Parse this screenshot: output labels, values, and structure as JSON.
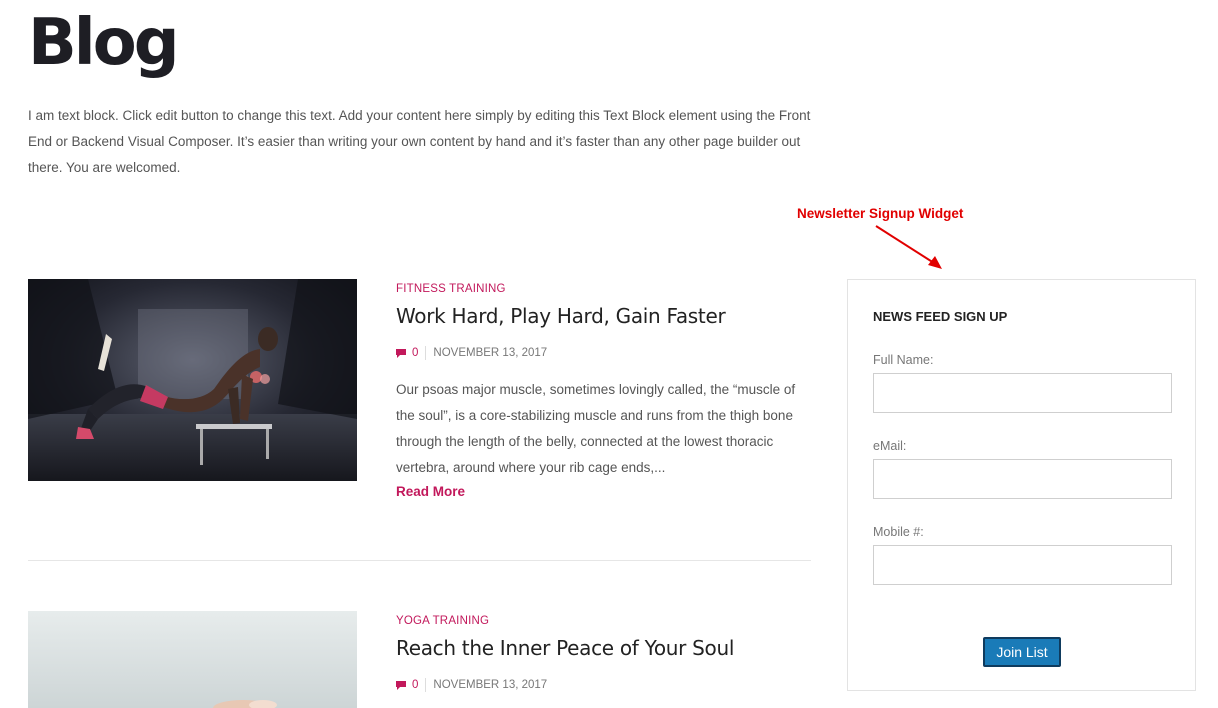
{
  "page": {
    "title": "Blog",
    "intro": "I am text block. Click edit button to change this text. Add your content here simply by editing this Text Block element using the Front End or Backend Visual Composer. It’s easier than writing your own content by hand and it’s faster than any other page builder out there. You are welcomed."
  },
  "annotation": {
    "label": "Newsletter Signup Widget",
    "color": "#e10000"
  },
  "posts": [
    {
      "category": "FITNESS TRAINING",
      "title": "Work Hard, Play Hard, Gain Faster",
      "comments": "0",
      "date": "NOVEMBER 13, 2017",
      "excerpt": "Our psoas major muscle, sometimes lovingly called, the “muscle of the soul”, is a core-stabilizing muscle and runs from the thigh bone through the length of the belly, connected at the lowest thoracic vertebra, around where your rib cage ends,...",
      "read_more": "Read More",
      "image_icon": "athlete-pushup-photo"
    },
    {
      "category": "YOGA TRAINING",
      "title": "Reach the Inner Peace of Your Soul",
      "comments": "0",
      "date": "NOVEMBER 13, 2017",
      "image_icon": "yoga-photo"
    }
  ],
  "widget": {
    "title": "NEWS FEED SIGN UP",
    "fields": [
      {
        "label": "Full Name:",
        "value": ""
      },
      {
        "label": "eMail:",
        "value": ""
      },
      {
        "label": "Mobile #:",
        "value": ""
      }
    ],
    "button_label": "Join List"
  },
  "colors": {
    "accent": "#c2185b",
    "button": "#1a7bb8",
    "annotation": "#e10000"
  }
}
